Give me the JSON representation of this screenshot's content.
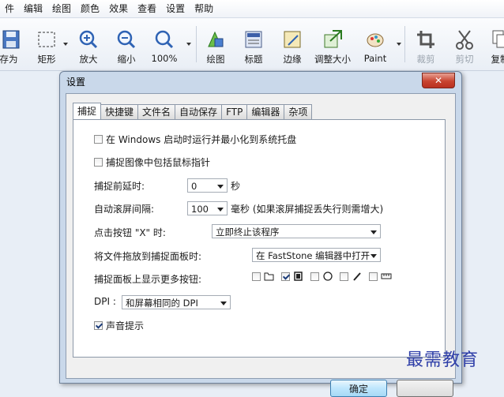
{
  "menubar": {
    "items": [
      "件",
      "编辑",
      "绘图",
      "颜色",
      "效果",
      "查看",
      "设置",
      "帮助"
    ]
  },
  "toolbar": {
    "buttons": [
      {
        "label": "存为",
        "icon": "save-icon"
      },
      {
        "label": "矩形",
        "icon": "rectangle-select-icon"
      },
      {
        "label": "放大",
        "icon": "zoom-in-icon"
      },
      {
        "label": "缩小",
        "icon": "zoom-out-icon"
      },
      {
        "label": "100%",
        "icon": "zoom-100-icon"
      },
      {
        "label": "绘图",
        "icon": "draw-icon"
      },
      {
        "label": "标题",
        "icon": "caption-icon"
      },
      {
        "label": "边缘",
        "icon": "edge-icon"
      },
      {
        "label": "调整大小",
        "icon": "resize-icon"
      },
      {
        "label": "Paint",
        "icon": "paint-icon"
      },
      {
        "label": "裁剪",
        "icon": "crop-icon"
      },
      {
        "label": "剪切",
        "icon": "cut-icon"
      },
      {
        "label": "复制",
        "icon": "copy-icon"
      }
    ]
  },
  "dialog": {
    "title": "设置",
    "close_label": "✕",
    "tabs": [
      "捕捉",
      "快捷键",
      "文件名",
      "自动保存",
      "FTP",
      "编辑器",
      "杂项"
    ],
    "options": {
      "minimize_to_tray": {
        "label": "在 Windows 启动时运行并最小化到系统托盘",
        "checked": false
      },
      "include_cursor": {
        "label": "捕捉图像中包括鼠标指针",
        "checked": false
      },
      "delay": {
        "label": "捕捉前延时:",
        "value": "0",
        "unit": "秒"
      },
      "scroll_interval": {
        "label": "自动滚屏间隔:",
        "value": "100",
        "unit": "毫秒 (如果滚屏捕捉丢失行则需增大)"
      },
      "x_button": {
        "label": "点击按钮 \"X\" 时:",
        "value": "立即终止该程序"
      },
      "drag_file": {
        "label": "将文件拖放到捕捉面板时:",
        "value": "在 FastStone 编辑器中打开"
      },
      "more_buttons": {
        "label": "捕捉面板上显示更多按钮:",
        "checks": [
          false,
          true,
          false,
          false,
          false
        ]
      },
      "dpi": {
        "label": "DPI :",
        "value": "和屏幕相同的 DPI"
      },
      "sound": {
        "label": "声音提示",
        "checked": true
      }
    },
    "ok_label": "确定"
  },
  "watermark": "最需教育"
}
